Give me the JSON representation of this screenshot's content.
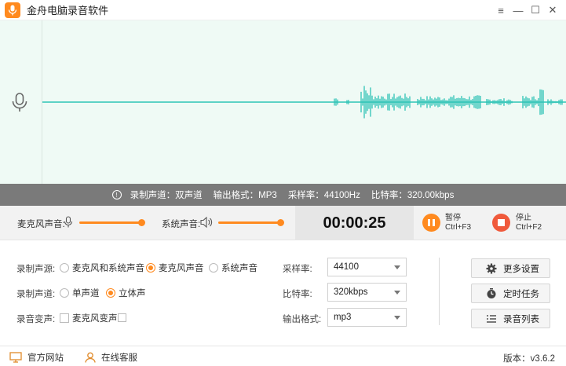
{
  "app": {
    "title": "金舟电脑录音软件"
  },
  "window_controls": {
    "menu": "≡",
    "minimize": "—",
    "maximize": "☐",
    "close": "✕"
  },
  "info_bar": {
    "channel": "录制声道：双声道",
    "format": "输出格式：MP3",
    "sample_rate": "采样率：44100Hz",
    "bitrate": "比特率：320.00kbps"
  },
  "controls": {
    "mic_volume_label": "麦克风声音:",
    "mic_volume_level": 1.0,
    "system_volume_label": "系统声音:",
    "system_volume_level": 1.0,
    "timer": "00:00:25",
    "pause_label": "暂停",
    "pause_shortcut": "Ctrl+F3",
    "stop_label": "停止",
    "stop_shortcut": "Ctrl+F2"
  },
  "settings": {
    "source_label": "录制声源:",
    "source_options": [
      "麦克风和系统声音",
      "麦克风声音",
      "系统声音"
    ],
    "source_selected": "麦克风声音",
    "channel_label": "录制声道:",
    "channel_options": [
      "单声道",
      "立体声"
    ],
    "channel_selected": "立体声",
    "voice_change_label": "录音变声:",
    "voice_change_option": "麦克风变声",
    "sample_rate_label": "采样率:",
    "sample_rate_value": "44100",
    "bitrate_label": "比特率:",
    "bitrate_value": "320kbps",
    "format_label": "输出格式:",
    "format_value": "mp3",
    "more_settings": "更多设置",
    "scheduled_task": "定时任务",
    "record_list": "录音列表"
  },
  "footer": {
    "official_site": "官方网站",
    "online_service": "在线客服",
    "version": "版本：v3.6.2"
  },
  "colors": {
    "accent": "#ff8a1f",
    "wave": "#2ec4b6",
    "stop": "#f05a3c",
    "info_bar": "#7a7a7a"
  }
}
